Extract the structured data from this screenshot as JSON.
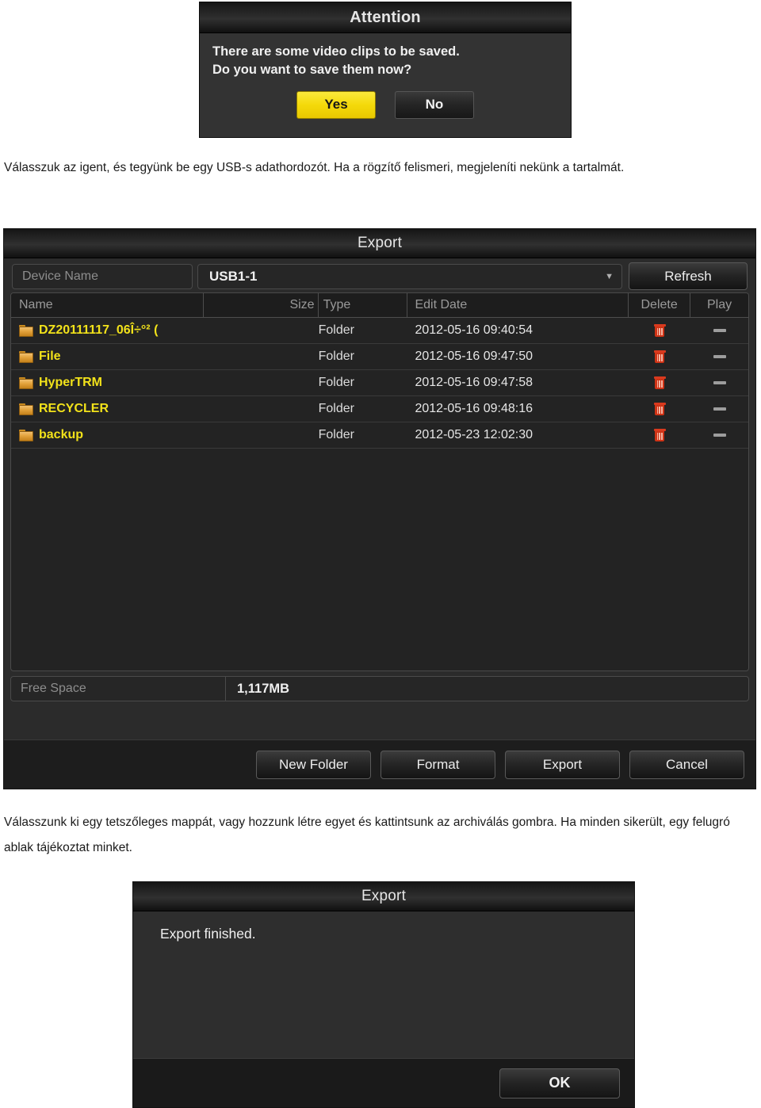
{
  "attention_dialog": {
    "title": "Attention",
    "message_line1": "There are some video clips to be saved.",
    "message_line2": "Do you want to save them now?",
    "yes_label": "Yes",
    "no_label": "No",
    "yes_color": "#f4d90a"
  },
  "prose": {
    "top": "Válasszuk az igent, és tegyünk be egy USB-s adathordozót. Ha a rögzítő felismeri, megjeleníti nekünk a tartalmát.",
    "bottom": "Válasszunk ki egy tetszőleges mappát, vagy hozzunk létre egyet és kattintsunk az archiválás gombra. Ha minden sikerült, egy felugró ablak tájékoztat minket."
  },
  "export_panel": {
    "title": "Export",
    "device_name_label": "Device Name",
    "device_name_value": "USB1-1",
    "dropdown_icon": "chevron-down-icon",
    "refresh_label": "Refresh",
    "columns": [
      "Name",
      "Size",
      "Type",
      "Edit Date",
      "Delete",
      "Play"
    ],
    "rows": [
      {
        "name": "DZ20111117_06Î÷°² (",
        "size": "",
        "type": "Folder",
        "edit_date": "2012-05-16 09:40:54",
        "delete_icon": "trash-icon",
        "play_icon": "dash-icon"
      },
      {
        "name": "File",
        "size": "",
        "type": "Folder",
        "edit_date": "2012-05-16 09:47:50",
        "delete_icon": "trash-icon",
        "play_icon": "dash-icon"
      },
      {
        "name": "HyperTRM",
        "size": "",
        "type": "Folder",
        "edit_date": "2012-05-16 09:47:58",
        "delete_icon": "trash-icon",
        "play_icon": "dash-icon"
      },
      {
        "name": "RECYCLER",
        "size": "",
        "type": "Folder",
        "edit_date": "2012-05-16 09:48:16",
        "delete_icon": "trash-icon",
        "play_icon": "dash-icon"
      },
      {
        "name": "backup",
        "size": "",
        "type": "Folder",
        "edit_date": "2012-05-23 12:02:30",
        "delete_icon": "trash-icon",
        "play_icon": "dash-icon"
      }
    ],
    "free_space_label": "Free Space",
    "free_space_value": "1,117MB",
    "buttons": [
      "New Folder",
      "Format",
      "Export",
      "Cancel"
    ],
    "folder_name_color": "#f2e21a",
    "trash_color": "#cf3316"
  },
  "finished_dialog": {
    "title": "Export",
    "message": "Export finished.",
    "ok_label": "OK"
  }
}
